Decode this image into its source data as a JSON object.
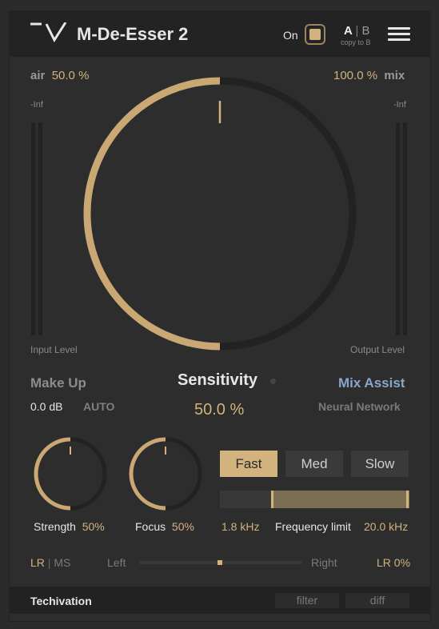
{
  "header": {
    "title": "M-De-Esser 2",
    "on_label": "On",
    "a": "A",
    "sep": "|",
    "b": "B",
    "copy_to": "copy to B"
  },
  "main": {
    "air_label": "air",
    "air_value": "50.0 %",
    "mix_value": "100.0 %",
    "mix_label": "mix",
    "input_inf": "-Inf",
    "output_inf": "-Inf",
    "input_level_label": "Input Level",
    "output_level_label": "Output Level",
    "sensitivity_label": "Sensitivity",
    "sensitivity_value": "50.0 %",
    "sensitivity_level": 0.5
  },
  "makeup": {
    "label": "Make Up",
    "value": "0.0 dB",
    "auto_label": "AUTO"
  },
  "mix_assist": {
    "label": "Mix Assist",
    "subtitle": "Neural Network"
  },
  "knobs": {
    "strength": {
      "label": "Strength",
      "value": "50%",
      "level": 0.5
    },
    "focus": {
      "label": "Focus",
      "value": "50%",
      "level": 0.5
    }
  },
  "speed": {
    "fast": "Fast",
    "med": "Med",
    "slow": "Slow",
    "selected": "Fast"
  },
  "frequency": {
    "low": "1.8 kHz",
    "label": "Frequency limit",
    "high": "20.0 kHz"
  },
  "stereo": {
    "lr": "LR",
    "sep": "|",
    "ms": "MS",
    "left": "Left",
    "right": "Right",
    "value": "LR 0%",
    "pan": 0.5
  },
  "footer": {
    "brand": "Techivation",
    "filter": "filter",
    "diff": "diff"
  },
  "colors": {
    "accent": "#d2b27d",
    "mix_assist": "#8aa6c8"
  }
}
